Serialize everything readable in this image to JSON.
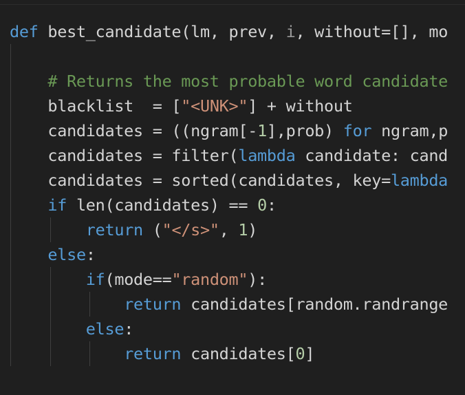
{
  "editor": {
    "lines": [
      [
        {
          "t": "def",
          "c": "kw"
        },
        {
          "t": " best_candidate(lm, prev, ",
          "c": "plain"
        },
        {
          "t": "i",
          "c": "dim"
        },
        {
          "t": ", without=[], mo",
          "c": "plain"
        }
      ],
      [],
      [
        {
          "t": "    # Returns the most probable word candidate",
          "c": "cmt"
        }
      ],
      [
        {
          "t": "    blacklist  = [",
          "c": "plain"
        },
        {
          "t": "\"<UNK>\"",
          "c": "str"
        },
        {
          "t": "] + without",
          "c": "plain"
        }
      ],
      [
        {
          "t": "    candidates = ((ngram[-",
          "c": "plain"
        },
        {
          "t": "1",
          "c": "num"
        },
        {
          "t": "],prob) ",
          "c": "plain"
        },
        {
          "t": "for",
          "c": "ctlblue"
        },
        {
          "t": " ngram,p",
          "c": "plain"
        }
      ],
      [
        {
          "t": "    candidates = filter(",
          "c": "plain"
        },
        {
          "t": "lambda",
          "c": "kw"
        },
        {
          "t": " candidate: cand",
          "c": "plain"
        }
      ],
      [
        {
          "t": "    candidates = sorted(candidates, key=",
          "c": "plain"
        },
        {
          "t": "lambda",
          "c": "kw"
        }
      ],
      [
        {
          "t": "    ",
          "c": "plain"
        },
        {
          "t": "if",
          "c": "ctlblue"
        },
        {
          "t": " len(candidates) == ",
          "c": "plain"
        },
        {
          "t": "0",
          "c": "num"
        },
        {
          "t": ":",
          "c": "plain"
        }
      ],
      [
        {
          "t": "        ",
          "c": "plain"
        },
        {
          "t": "return",
          "c": "ctlblue"
        },
        {
          "t": " (",
          "c": "plain"
        },
        {
          "t": "\"</s>\"",
          "c": "str"
        },
        {
          "t": ", ",
          "c": "plain"
        },
        {
          "t": "1",
          "c": "num"
        },
        {
          "t": ")",
          "c": "plain"
        }
      ],
      [
        {
          "t": "    ",
          "c": "plain"
        },
        {
          "t": "else",
          "c": "ctlblue"
        },
        {
          "t": ":",
          "c": "plain"
        }
      ],
      [
        {
          "t": "        ",
          "c": "plain"
        },
        {
          "t": "if",
          "c": "ctlblue"
        },
        {
          "t": "(mode==",
          "c": "plain"
        },
        {
          "t": "\"random\"",
          "c": "str"
        },
        {
          "t": "):",
          "c": "plain"
        }
      ],
      [
        {
          "t": "            ",
          "c": "plain"
        },
        {
          "t": "return",
          "c": "ctlblue"
        },
        {
          "t": " candidates[random.randrange",
          "c": "plain"
        }
      ],
      [
        {
          "t": "        ",
          "c": "plain"
        },
        {
          "t": "else",
          "c": "ctlblue"
        },
        {
          "t": ":",
          "c": "plain"
        }
      ],
      [
        {
          "t": "            ",
          "c": "plain"
        },
        {
          "t": "return",
          "c": "ctlblue"
        },
        {
          "t": " candidates[",
          "c": "plain"
        },
        {
          "t": "0",
          "c": "num"
        },
        {
          "t": "]",
          "c": "plain"
        }
      ]
    ]
  }
}
